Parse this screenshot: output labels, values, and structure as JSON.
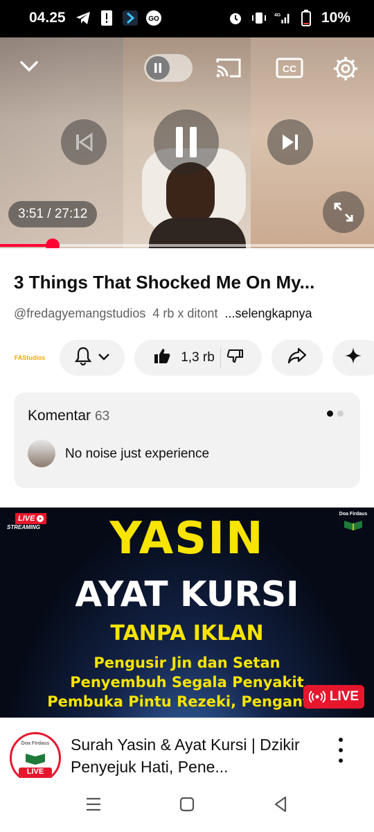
{
  "status_bar": {
    "time": "04.25",
    "battery": "10%",
    "network": "4G"
  },
  "player": {
    "time_display": "3:51 / 27:12",
    "progress": 0.141,
    "icons": {
      "collapse": "chevron-down-icon",
      "autoplay": "autoplay-toggle-icon",
      "cast": "cast-icon",
      "captions": "closed-captions-icon",
      "settings": "gear-icon",
      "previous": "skip-previous-icon",
      "pause": "pause-icon",
      "next": "skip-next-icon",
      "fullscreen": "fullscreen-icon"
    }
  },
  "video": {
    "title": "3 Things That Shocked Me On My...",
    "channel_handle": "@fredagyemangstudios",
    "views": "4 rb x ditont",
    "more_label": "...selengkapnya",
    "channel_avatar_text": "FAStudios",
    "like_count": "1,3 rb"
  },
  "comments": {
    "label": "Komentar",
    "count": "63",
    "top_comment": "No noise just experience"
  },
  "next_video": {
    "badge_live_top": "LIVE",
    "badge_streaming": "STREAMING",
    "brand": "Doa Firdaus",
    "thumb_line1": "YASIN",
    "thumb_line2": "AYAT KURSI",
    "thumb_line3": "TANPA IKLAN",
    "thumb_line4": "Pengusir Jin dan Setan",
    "thumb_line5": "Penyembuh Segala Penyakit",
    "thumb_line6": "Pembuka Pintu Rezeki, Pengantar",
    "live_chip": "LIVE",
    "avatar_chip": "LIVE",
    "title": "Surah Yasin & Ayat Kursi | Dzikir Penyejuk Hati, Pene..."
  },
  "colors": {
    "accent_red": "#ff0033",
    "thumb_yellow": "#f7e400",
    "live_red": "#e6162d"
  }
}
